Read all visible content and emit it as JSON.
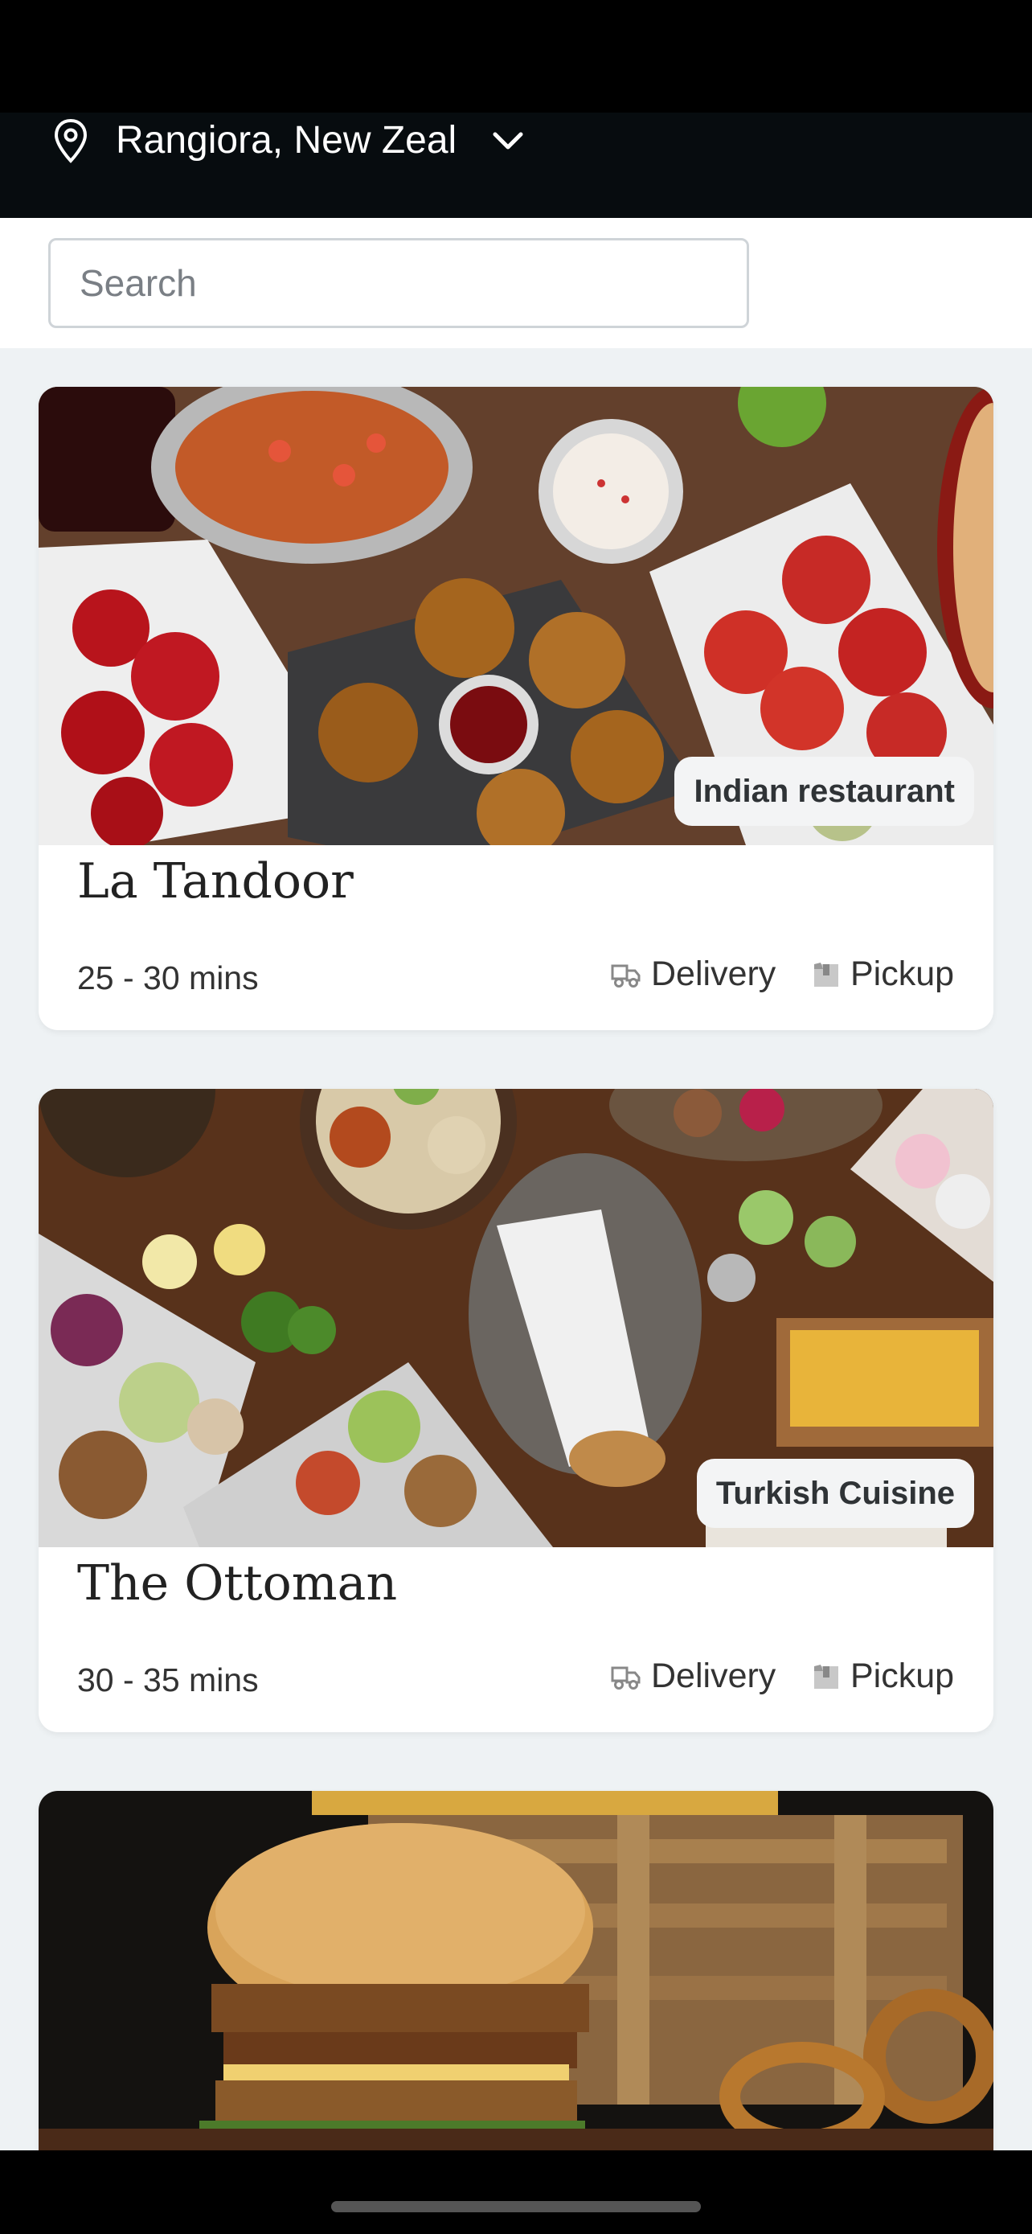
{
  "location": {
    "label": "Rangiora, New Zeal"
  },
  "search": {
    "placeholder": "Search"
  },
  "restaurants": [
    {
      "name": "La Tandoor",
      "cuisine": "Indian restaurant",
      "time": "25 - 30 mins",
      "delivery_label": "Delivery",
      "pickup_label": "Pickup"
    },
    {
      "name": "The Ottoman",
      "cuisine": "Turkish Cuisine",
      "time": "30 - 35 mins",
      "delivery_label": "Delivery",
      "pickup_label": "Pickup"
    },
    {
      "name": "",
      "cuisine": "",
      "time": "",
      "delivery_label": "",
      "pickup_label": ""
    }
  ],
  "icons": {
    "location": "map-pin-icon",
    "dropdown": "chevron-down-icon",
    "delivery": "delivery-truck-icon",
    "pickup": "pickup-bag-icon"
  },
  "colors": {
    "header_bg": "#070c0f",
    "page_bg": "#eef2f4",
    "card_bg": "#ffffff",
    "badge_bg": "#f3f4f5"
  }
}
